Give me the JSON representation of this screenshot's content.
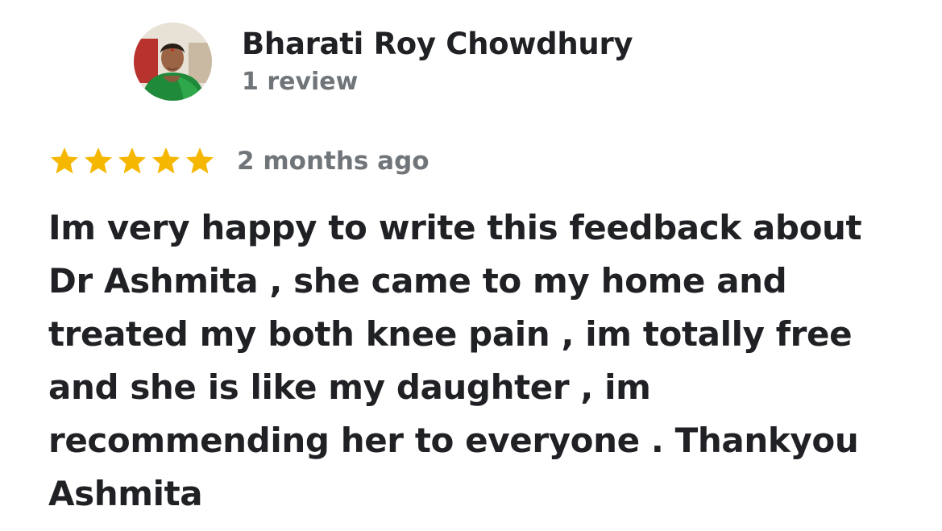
{
  "reviewer": {
    "name": "Bharati Roy Chowdhury",
    "review_count": "1 review",
    "avatar_icon": "user-avatar-photo"
  },
  "rating": {
    "stars": 5,
    "max": 5,
    "star_color": "#f6b700",
    "icon": "star-icon"
  },
  "review": {
    "time": "2 months ago",
    "lines": [
      "Im very happy to write this feedback about",
      "Dr Ashmita , she came to my home and",
      "treated my both knee pain , im totally free",
      "and she is like my daughter , im",
      "recommending her to everyone . Thankyou",
      "Ashmita"
    ]
  },
  "colors": {
    "primary_text": "#202124",
    "secondary_text": "#70757a"
  }
}
